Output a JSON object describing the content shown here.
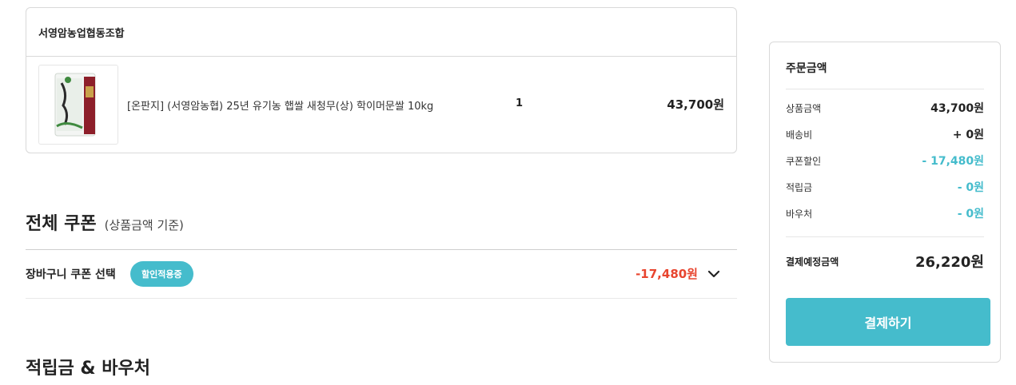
{
  "seller": {
    "name": "서영암농업협동조합",
    "product": {
      "name": "[온판지] (서영암농협) 25년 유기농 햅쌀 새청무(상) 학이머문쌀 10kg",
      "quantity": "1",
      "price": "43,700원"
    }
  },
  "coupon_section": {
    "title": "전체 쿠폰",
    "subtitle": "(상품금액 기준)",
    "cart_coupon_label": "장바구니 쿠폰 선택",
    "badge": "할인적용중",
    "amount": "-17,480원"
  },
  "points_section": {
    "title": "적립금 & 바우처"
  },
  "summary": {
    "title": "주문금액",
    "rows": [
      {
        "label": "상품금액",
        "value": "43,700원"
      },
      {
        "label": "배송비",
        "value": "+ 0원"
      },
      {
        "label": "쿠폰할인",
        "value": "- 17,480원"
      },
      {
        "label": "적립금",
        "value": "- 0원"
      },
      {
        "label": "바우처",
        "value": "- 0원"
      }
    ],
    "total_label": "결제예정금액",
    "total_value": "26,220원",
    "pay_button": "결제하기"
  },
  "colors": {
    "accent": "#45bccc",
    "discount_red": "#e8452f"
  }
}
